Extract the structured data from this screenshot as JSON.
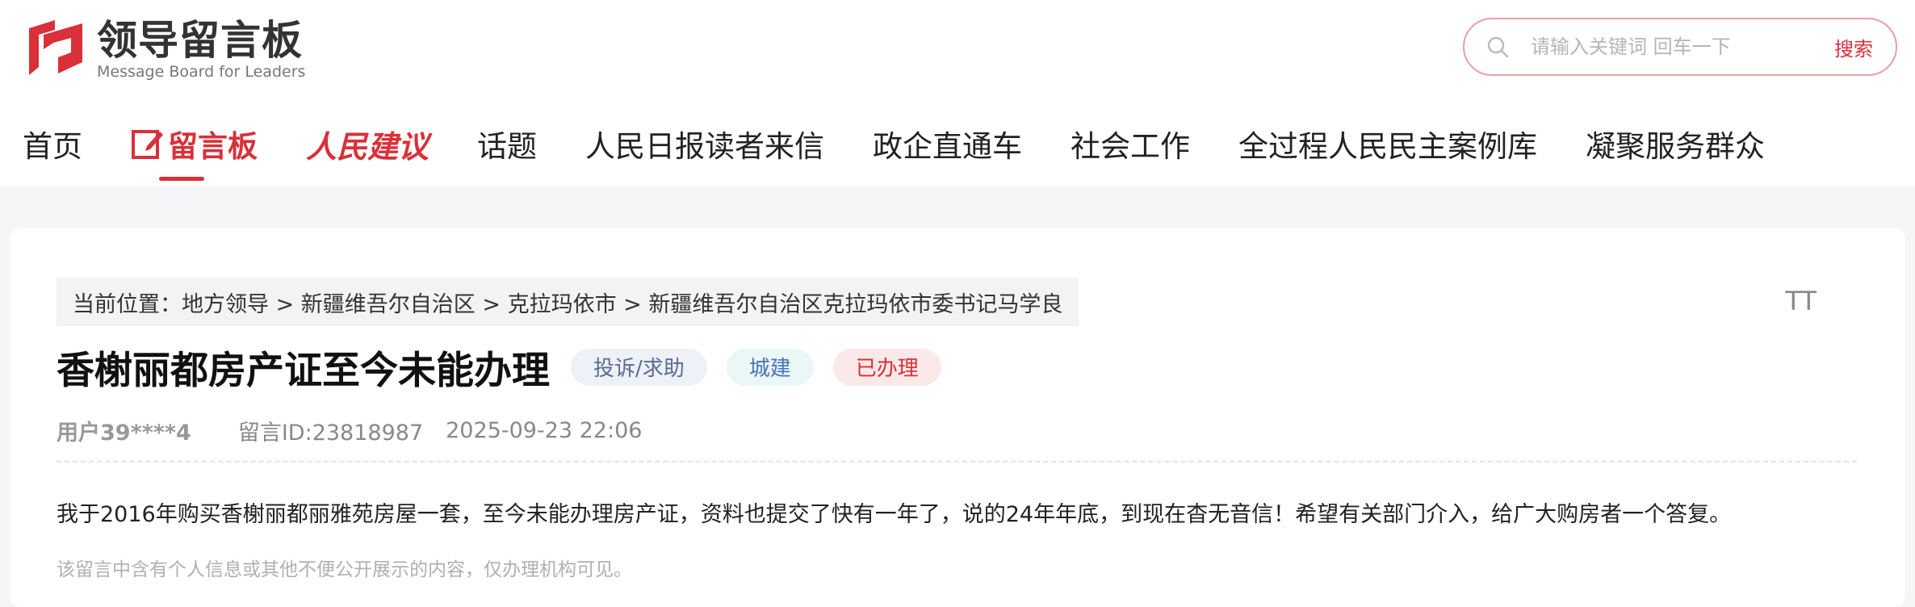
{
  "header": {
    "logo_cn": "领导留言板",
    "logo_en": "Message Board for Leaders",
    "logo_icon": "logo-icon",
    "search": {
      "placeholder": "请输入关键词 回车一下",
      "button_label": "搜索",
      "icon": "search-icon"
    },
    "nav": [
      {
        "label": "首页"
      },
      {
        "label": "留言板",
        "active": true,
        "icon": "edit-icon"
      },
      {
        "label": "人民建议"
      },
      {
        "label": "话题"
      },
      {
        "label": "人民日报读者来信"
      },
      {
        "label": "政企直通车"
      },
      {
        "label": "社会工作"
      },
      {
        "label": "全过程人民民主案例库"
      },
      {
        "label": "凝聚服务群众"
      }
    ]
  },
  "message": {
    "breadcrumb": "当前位置：地方领导 > 新疆维吾尔自治区 > 克拉玛依市 > 新疆维吾尔自治区克拉玛依市委书记马学良",
    "font_toggle": "TT",
    "title": "香榭丽都房产证至今未能办理",
    "tags": {
      "type": "投诉/求助",
      "domain": "城建",
      "status": "已办理"
    },
    "user": "用户39****4",
    "id_text": "留言ID:23818987",
    "time": "2025-09-23 22:06",
    "body": "我于2016年购买香榭丽都丽雅苑房屋一套，至今未能办理房产证，资料也提交了快有一年了，说的24年年底，到现在杳无音信！希望有关部门介入，给广大购房者一个答复。",
    "notice": "该留言中含有个人信息或其他不便公开展示的内容，仅办理机构可见。"
  },
  "colors": {
    "accent": "#d9303a",
    "page_bg": "#f5f6f8"
  }
}
